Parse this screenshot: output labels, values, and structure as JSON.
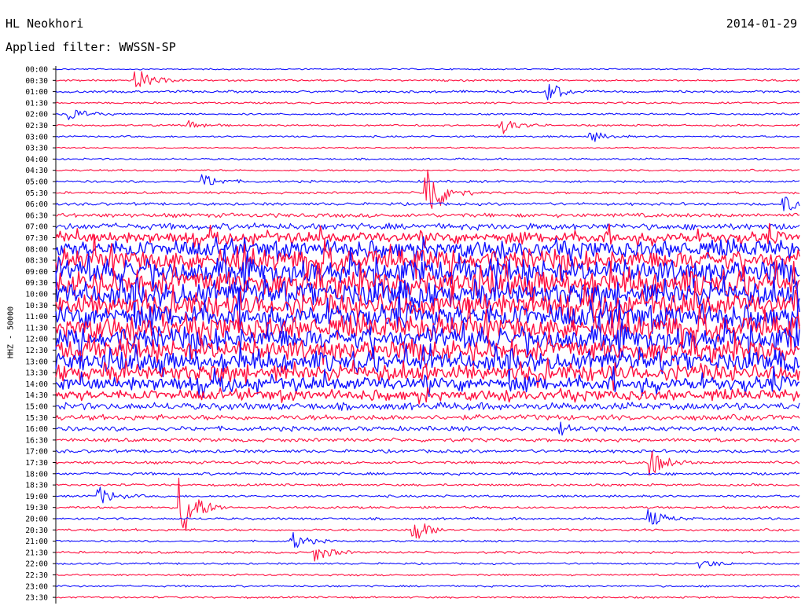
{
  "header": {
    "station": "HL Neokhori",
    "date": "2014-01-29",
    "filter_label": "Applied filter: WWSSN-SP"
  },
  "chart_data": {
    "type": "helicorder",
    "channel_label": "HHZ - 50000",
    "colors": {
      "odd_rows": "#1010ff",
      "even_rows": "#ff1040"
    },
    "grid": false,
    "rows": [
      {
        "label": "00:00",
        "amp": 0.15
      },
      {
        "label": "00:30",
        "amp": 0.2
      },
      {
        "label": "01:00",
        "amp": 0.25
      },
      {
        "label": "01:30",
        "amp": 0.2
      },
      {
        "label": "02:00",
        "amp": 0.2
      },
      {
        "label": "02:30",
        "amp": 0.2
      },
      {
        "label": "03:00",
        "amp": 0.2
      },
      {
        "label": "03:30",
        "amp": 0.15
      },
      {
        "label": "04:00",
        "amp": 0.2
      },
      {
        "label": "04:30",
        "amp": 0.2
      },
      {
        "label": "05:00",
        "amp": 0.25
      },
      {
        "label": "05:30",
        "amp": 0.25
      },
      {
        "label": "06:00",
        "amp": 0.3
      },
      {
        "label": "06:30",
        "amp": 0.45
      },
      {
        "label": "07:00",
        "amp": 0.7
      },
      {
        "label": "07:30",
        "amp": 1.2
      },
      {
        "label": "08:00",
        "amp": 1.8
      },
      {
        "label": "08:30",
        "amp": 2.2
      },
      {
        "label": "09:00",
        "amp": 2.5
      },
      {
        "label": "09:30",
        "amp": 2.6
      },
      {
        "label": "10:00",
        "amp": 2.6
      },
      {
        "label": "10:30",
        "amp": 2.5
      },
      {
        "label": "11:00",
        "amp": 2.5
      },
      {
        "label": "11:30",
        "amp": 2.4
      },
      {
        "label": "12:00",
        "amp": 2.4
      },
      {
        "label": "12:30",
        "amp": 2.2
      },
      {
        "label": "13:00",
        "amp": 2.0
      },
      {
        "label": "13:30",
        "amp": 1.8
      },
      {
        "label": "14:00",
        "amp": 1.5
      },
      {
        "label": "14:30",
        "amp": 1.1
      },
      {
        "label": "15:00",
        "amp": 0.8
      },
      {
        "label": "15:30",
        "amp": 0.6
      },
      {
        "label": "16:00",
        "amp": 0.5
      },
      {
        "label": "16:30",
        "amp": 0.4
      },
      {
        "label": "17:00",
        "amp": 0.35
      },
      {
        "label": "17:30",
        "amp": 0.3
      },
      {
        "label": "18:00",
        "amp": 0.3
      },
      {
        "label": "18:30",
        "amp": 0.25
      },
      {
        "label": "19:00",
        "amp": 0.25
      },
      {
        "label": "19:30",
        "amp": 0.25
      },
      {
        "label": "20:00",
        "amp": 0.25
      },
      {
        "label": "20:30",
        "amp": 0.25
      },
      {
        "label": "21:00",
        "amp": 0.2
      },
      {
        "label": "21:30",
        "amp": 0.25
      },
      {
        "label": "22:00",
        "amp": 0.2
      },
      {
        "label": "22:30",
        "amp": 0.2
      },
      {
        "label": "23:00",
        "amp": 0.2
      },
      {
        "label": "23:30",
        "amp": 0.2
      }
    ],
    "events": [
      {
        "row": "00:30",
        "t": 0.11,
        "amp": 2.0
      },
      {
        "row": "01:00",
        "t": 0.66,
        "amp": 2.0
      },
      {
        "row": "02:00",
        "t": 0.02,
        "amp": 1.2
      },
      {
        "row": "02:30",
        "t": 0.6,
        "amp": 1.5
      },
      {
        "row": "02:30",
        "t": 0.18,
        "amp": 0.8
      },
      {
        "row": "03:00",
        "t": 0.72,
        "amp": 1.0
      },
      {
        "row": "05:00",
        "t": 0.2,
        "amp": 1.2
      },
      {
        "row": "05:30",
        "t": 0.5,
        "amp": 6.0
      },
      {
        "row": "06:00",
        "t": 0.98,
        "amp": 1.5
      },
      {
        "row": "16:00",
        "t": 0.68,
        "amp": 1.0
      },
      {
        "row": "17:30",
        "t": 0.8,
        "amp": 2.5
      },
      {
        "row": "19:00",
        "t": 0.06,
        "amp": 1.5
      },
      {
        "row": "19:30",
        "t": 0.17,
        "amp": 6.0
      },
      {
        "row": "20:00",
        "t": 0.8,
        "amp": 1.5
      },
      {
        "row": "20:30",
        "t": 0.48,
        "amp": 2.5
      },
      {
        "row": "21:00",
        "t": 0.32,
        "amp": 1.5
      },
      {
        "row": "21:30",
        "t": 0.35,
        "amp": 1.5
      },
      {
        "row": "22:00",
        "t": 0.87,
        "amp": 0.8
      }
    ]
  }
}
